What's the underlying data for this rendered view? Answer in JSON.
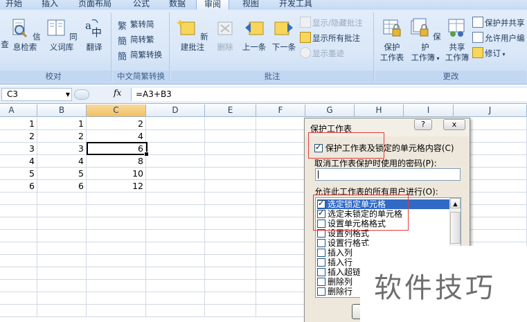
{
  "tabs": [
    {
      "label": "开始",
      "active": false
    },
    {
      "label": "插入",
      "active": false
    },
    {
      "label": "页面布局",
      "active": false
    },
    {
      "label": "公式",
      "active": false
    },
    {
      "label": "数据",
      "active": false
    },
    {
      "label": "审阅",
      "active": true
    },
    {
      "label": "视图",
      "active": false
    },
    {
      "label": "开发工具",
      "active": false
    }
  ],
  "ribbon": {
    "proofing": {
      "label": "校对",
      "research_partial": "查",
      "research": "信息检索",
      "thesaurus": "同义词库",
      "translate": "翻译"
    },
    "chinese_conversion": {
      "label": "中文简繁转换",
      "to_traditional": "繁转简",
      "to_simplified": "简转繁",
      "convert": "简繁转换"
    },
    "comments": {
      "label": "批注",
      "new_comment": "新建批注",
      "delete": "删除",
      "previous": "上一条",
      "next": "下一条",
      "show_hide": "显示/隐藏批注",
      "show_all": "显示所有批注",
      "show_ink": "显示墨迹"
    },
    "changes": {
      "label": "更改",
      "protect_sheet_line1": "保护",
      "protect_sheet_line2": "工作表",
      "protect_workbook_line1": "保护",
      "protect_workbook_line2": "工作簿",
      "share_workbook_line1": "共享",
      "share_workbook_line2": "工作簿",
      "protect_and_share": "保护并共享",
      "allow_users_edit": "允许用户编",
      "track_changes": "修订"
    }
  },
  "formula_bar": {
    "name_box": "C3",
    "fx": "fx",
    "formula": "=A3+B3"
  },
  "sheet": {
    "columns": [
      "A",
      "B",
      "C",
      "D",
      "E",
      "F",
      "G",
      "H",
      "I",
      "J"
    ],
    "selected_column": "C",
    "active_cell": "C3",
    "rows": [
      [
        "1",
        "1",
        "2"
      ],
      [
        "2",
        "2",
        "4"
      ],
      [
        "3",
        "3",
        "6"
      ],
      [
        "4",
        "4",
        "8"
      ],
      [
        "5",
        "5",
        "10"
      ],
      [
        "6",
        "6",
        "12"
      ]
    ]
  },
  "dialog": {
    "title": "保护工作表",
    "help": "?",
    "close": "x",
    "protect_label": "保护工作表及锁定的单元格内容(C)",
    "protect_checked": true,
    "password_label": "取消工作表保护时使用的密码(P):",
    "password_value": "",
    "permissions_label": "允许此工作表的所有用户进行(O):",
    "permissions": [
      {
        "label": "选定锁定单元格",
        "checked": true,
        "highlighted": true
      },
      {
        "label": "选定未锁定的单元格",
        "checked": true,
        "highlighted": false
      },
      {
        "label": "设置单元格格式",
        "checked": false,
        "highlighted": false
      },
      {
        "label": "设置列格式",
        "checked": false,
        "highlighted": false
      },
      {
        "label": "设置行格式",
        "checked": false,
        "highlighted": false
      },
      {
        "label": "插入列",
        "checked": false,
        "highlighted": false
      },
      {
        "label": "插入行",
        "checked": false,
        "highlighted": false
      },
      {
        "label": "插入超链接",
        "checked": false,
        "highlighted": false
      },
      {
        "label": "删除列",
        "checked": false,
        "highlighted": false
      },
      {
        "label": "删除行",
        "checked": false,
        "highlighted": false
      }
    ]
  },
  "watermark": "软件技巧",
  "colors": {
    "highlight": "#316ac5",
    "annotation_red": "#e23b3b",
    "ribbon_text": "#1e395b"
  }
}
